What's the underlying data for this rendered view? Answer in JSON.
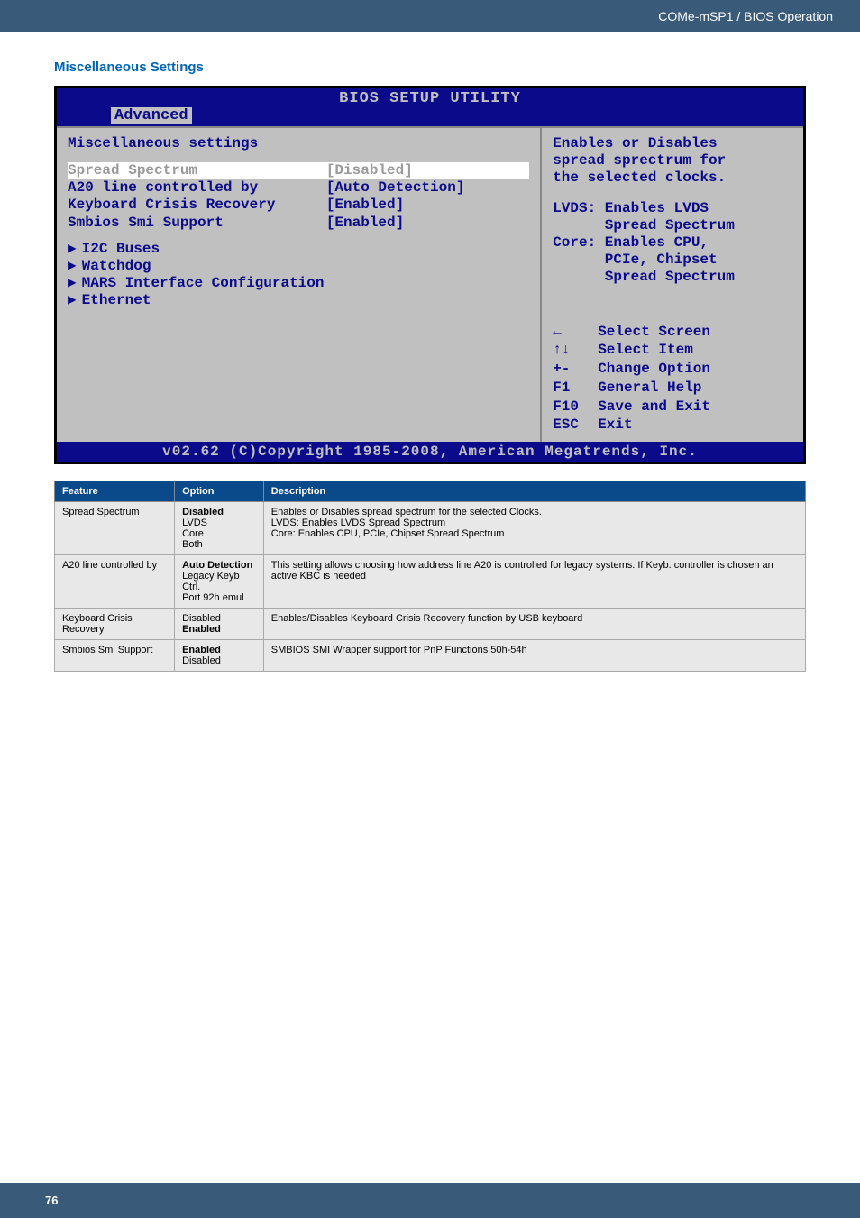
{
  "header": {
    "breadcrumb": "COMe-mSP1 / BIOS Operation"
  },
  "section_title": "Miscellaneous Settings",
  "bios": {
    "title": "BIOS SETUP UTILITY",
    "tab": "Advanced",
    "panel_heading": "Miscellaneous settings",
    "items": [
      {
        "label": "Spread Spectrum",
        "value": "[Disabled]",
        "selected": true
      },
      {
        "label": "A20 line controlled by",
        "value": "[Auto Detection]"
      },
      {
        "label": "Keyboard Crisis Recovery",
        "value": "[Enabled]"
      },
      {
        "label": "Smbios Smi Support",
        "value": "[Enabled]"
      }
    ],
    "submenus": [
      "I2C Buses",
      "Watchdog",
      "MARS Interface Configuration",
      "Ethernet"
    ],
    "help": {
      "line1": "Enables or Disables",
      "line2": "spread sprectrum for",
      "line3": "the selected clocks.",
      "line5": "LVDS: Enables LVDS",
      "line6": "      Spread Spectrum",
      "line7": "Core: Enables CPU,",
      "line8": "      PCIe, Chipset",
      "line9": "      Spread Spectrum"
    },
    "keys": {
      "k1": {
        "key": "←",
        "label": "Select Screen"
      },
      "k2": {
        "key": "↑↓",
        "label": "Select Item"
      },
      "k3": {
        "key": "+-",
        "label": "Change Option"
      },
      "k4": {
        "key": "F1",
        "label": "General Help"
      },
      "k5": {
        "key": "F10",
        "label": "Save and Exit"
      },
      "k6": {
        "key": "ESC",
        "label": "Exit"
      }
    },
    "footer": "v02.62 (C)Copyright 1985-2008, American Megatrends, Inc."
  },
  "table": {
    "headers": {
      "c1": "Feature",
      "c2": "Option",
      "c3": "Description"
    },
    "rows": [
      {
        "feature": "Spread Spectrum",
        "option_bold": "Disabled",
        "option_rest": "LVDS\nCore\nBoth",
        "desc": "Enables or Disables spread spectrum for the selected Clocks.\nLVDS: Enables LVDS Spread Spectrum\nCore: Enables CPU, PCIe, Chipset Spread Spectrum"
      },
      {
        "feature": "A20 line controlled by",
        "option_bold": "Auto Detection",
        "option_rest": "Legacy Keyb Ctrl.\nPort 92h emul",
        "desc": "This setting allows choosing how address line A20 is controlled for legacy systems. If Keyb. controller is chosen an active KBC is needed"
      },
      {
        "feature": "Keyboard Crisis Recovery",
        "option_pre": "Disabled",
        "option_bold": "Enabled",
        "desc": "Enables/Disables Keyboard Crisis Recovery function by USB keyboard"
      },
      {
        "feature": "Smbios Smi Support",
        "option_bold": "Enabled",
        "option_rest": "Disabled",
        "desc": "SMBIOS SMI Wrapper support for PnP Functions 50h-54h"
      }
    ]
  },
  "page_number": "76"
}
